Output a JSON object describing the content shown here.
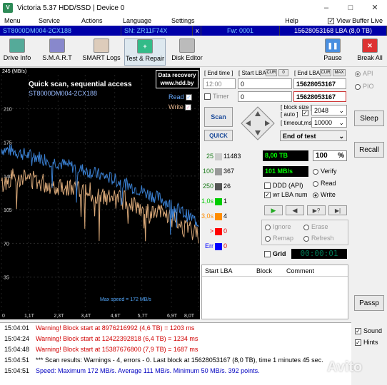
{
  "window": {
    "title": "Victoria 5.37 HDD/SSD | Device 0",
    "minimize": "–",
    "maximize": "□",
    "close": "✕"
  },
  "menu": {
    "items": [
      "Menu",
      "Service",
      "Actions",
      "Language",
      "Settings",
      "Help"
    ],
    "view_buffer": "View Buffer Live"
  },
  "drive": {
    "model": "ST8000DM004-2CX188",
    "serial": "SN: ZR11F74X",
    "close": "x",
    "firmware": "Fw: 0001",
    "capacity": "15628053168 LBA (8,0 TB)"
  },
  "toolbar": {
    "drive_info": "Drive Info",
    "smart": "S.M.A.R.T",
    "smart_logs": "SMART Logs",
    "test_repair": "Test & Repair",
    "disk_editor": "Disk Editor",
    "pause": "Pause",
    "break_all": "Break All"
  },
  "graph": {
    "ymax_label": "245 (MB/s)",
    "y_ticks": [
      "210",
      "175",
      "140",
      "105",
      "70",
      "35"
    ],
    "x_ticks": [
      "0",
      "1,1T",
      "2,3T",
      "3,4T",
      "4,6T",
      "5,7T",
      "6,9T",
      "8,0T"
    ],
    "scan_title": "Quick scan, sequential access",
    "drive_model": "ST8000DM004-2CX188",
    "recovery_line1": "Data recovery",
    "recovery_line2": "www.hdd.by",
    "read_label": "Read",
    "write_label": "Write",
    "max_speed": "Max speed = 172 MB/s",
    "colors": {
      "read": "#3a7fd0",
      "write": "#d9a878",
      "background": "#000000"
    }
  },
  "chart_data": {
    "type": "line",
    "xlabel": "",
    "ylabel": "(MB/s)",
    "xlim": [
      0,
      8.0
    ],
    "ylim": [
      0,
      245
    ],
    "series": [
      {
        "name": "Read",
        "x": [
          0,
          0.5,
          1.0,
          1.5,
          2.0,
          2.5,
          3.0,
          3.5,
          4.0,
          4.5,
          5.0,
          5.5,
          6.0,
          6.5,
          7.0,
          7.5,
          8.0
        ],
        "y": [
          168,
          166,
          162,
          160,
          156,
          152,
          149,
          145,
          141,
          137,
          132,
          127,
          121,
          116,
          108,
          100,
          92
        ]
      },
      {
        "name": "Write",
        "x": [
          0,
          0.5,
          1.0,
          1.5,
          2.0,
          2.5,
          3.0,
          3.5,
          4.0,
          4.5,
          5.0,
          5.5,
          6.0,
          6.5,
          7.0,
          7.5,
          8.0
        ],
        "y": [
          130,
          140,
          138,
          135,
          130,
          130,
          126,
          125,
          118,
          116,
          115,
          110,
          100,
          102,
          95,
          85,
          80
        ]
      }
    ]
  },
  "lba": {
    "end_time_label": "[ End time ]",
    "start_lba_label": "[ Start LBA ]",
    "cur_label": "CUR",
    "zero_label": "0",
    "end_lba_label": "[ End LBA ]",
    "max_label": "MAX",
    "end_time_value": "12:00",
    "start_lba_value": "0",
    "end_lba_value": "15628053167",
    "timer_label": "Timer",
    "timer_value": "0",
    "end_lba_value2": "15628053167"
  },
  "scan": {
    "scan_button": "Scan",
    "quick_button": "QUICK",
    "block_size_label": "[ block size ]",
    "auto_label": "[ auto ]",
    "block_size_value": "2048",
    "timeout_label": "[ timeout,ms ]",
    "timeout_value": "10000",
    "end_action": "End of test"
  },
  "stats": [
    {
      "ms": "25",
      "count": "11483",
      "color": "#cccccc"
    },
    {
      "ms": "100",
      "count": "367",
      "color": "#999999"
    },
    {
      "ms": "250",
      "count": "26",
      "color": "#555555"
    },
    {
      "ms": "1,0s",
      "count": "1",
      "color": "#00cc00"
    },
    {
      "ms": "3,0s",
      "count": "4",
      "color": "#ff8c00"
    },
    {
      "ms": ">",
      "count": "0",
      "color": "#ff0000"
    },
    {
      "ms": "Err",
      "count": "0",
      "color": "#0000ff"
    }
  ],
  "progress": {
    "size": "8,00 TB",
    "percent": "100",
    "percent_sign": "%",
    "speed": "101 MB/s"
  },
  "mode": {
    "verify": "Verify",
    "read": "Read",
    "write": "Write",
    "ddd": "DDD (API)",
    "wr_lba": "wr LBA num",
    "selected": "Write"
  },
  "repair": {
    "ignore": "Ignore",
    "erase": "Erase",
    "remap": "Remap",
    "refresh": "Refresh"
  },
  "grid": {
    "label": "Grid",
    "clock": "00:00:01"
  },
  "table": {
    "headers": [
      "Start LBA",
      "Block",
      "Comment"
    ]
  },
  "side": {
    "api": "API",
    "pio": "PIO",
    "sleep": "Sleep",
    "recall": "Recall",
    "passp": "Passp"
  },
  "options": {
    "sound": "Sound",
    "hints": "Hints"
  },
  "log": [
    {
      "time": "15:04:01",
      "text": "Warning! Block start at 8976216992 (4,6 TB)  = 1203 ms",
      "color": "#d00000"
    },
    {
      "time": "15:04:24",
      "text": "Warning! Block start at 12422392818 (6,4 TB)  = 1234 ms",
      "color": "#d00000"
    },
    {
      "time": "15:04:48",
      "text": "Warning! Block start at 15387676800 (7,9 TB)  = 1687 ms",
      "color": "#d00000"
    },
    {
      "time": "15:04:51",
      "text": "*** Scan results: Warnings - 4, errors - 0. Last block at 15628053167 (8,0 TB), time 1 minutes 45 sec.",
      "color": "#000000"
    },
    {
      "time": "15:04:51",
      "text": "Speed: Maximum 172 MB/s. Average 111 MB/s. Minimum 50 MB/s. 392 points.",
      "color": "#0000c0"
    }
  ],
  "watermark": "Avito"
}
